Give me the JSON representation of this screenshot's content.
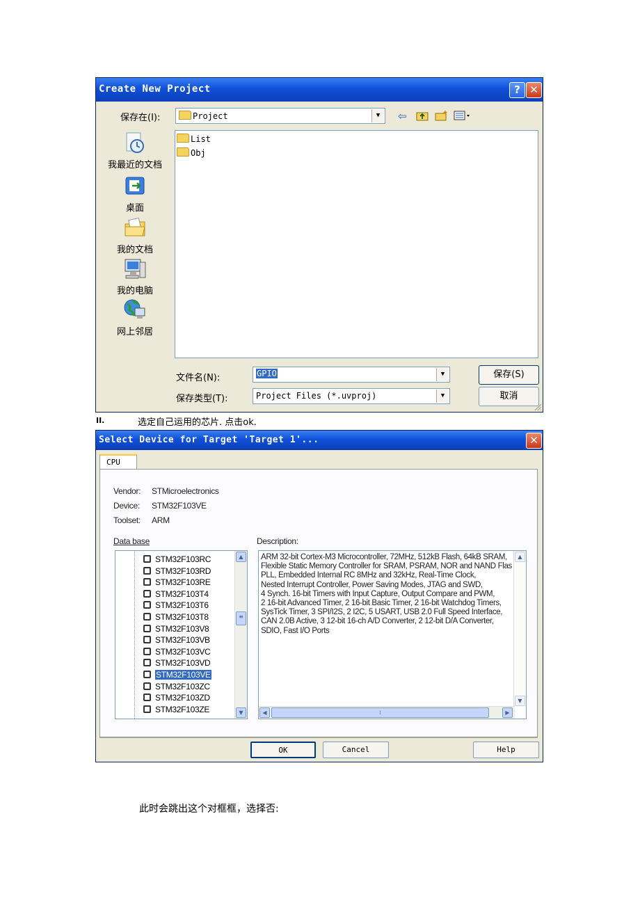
{
  "dialog1": {
    "title": "Create New Project",
    "save_in_label": "保存在(I):",
    "save_in_value": "Project",
    "places": [
      "我最近的文档",
      "桌面",
      "我的文档",
      "我的电脑",
      "网上邻居"
    ],
    "files": [
      "List",
      "Obj"
    ],
    "filename_label": "文件名(N):",
    "filename_value": "GPIO",
    "filetype_label": "保存类型(T):",
    "filetype_value": "Project Files (*.uvproj)",
    "save_button": "保存(S)",
    "cancel_button": "取消",
    "help_glyph": "?",
    "close_glyph": "✕"
  },
  "instruction": {
    "number": "II.",
    "text": "选定自己运用的芯片. 点击ok."
  },
  "dialog2": {
    "title": "Select Device for Target 'Target 1'...",
    "close_glyph": "✕",
    "tab": "CPU",
    "vendor_label": "Vendor:",
    "vendor_value": "STMicroelectronics",
    "device_label": "Device:",
    "device_value": "STM32F103VE",
    "toolset_label": "Toolset:",
    "toolset_value": "ARM",
    "database_label": "Data base",
    "description_label": "Description:",
    "devices": [
      "STM32F103RC",
      "STM32F103RD",
      "STM32F103RE",
      "STM32F103T4",
      "STM32F103T6",
      "STM32F103T8",
      "STM32F103V8",
      "STM32F103VB",
      "STM32F103VC",
      "STM32F103VD",
      "STM32F103VE",
      "STM32F103ZC",
      "STM32F103ZD",
      "STM32F103ZE"
    ],
    "selected_device": "STM32F103VE",
    "description": "ARM 32-bit Cortex-M3 Microcontroller, 72MHz, 512kB Flash, 64kB SRAM,\nFlexible Static Memory Controller for SRAM, PSRAM, NOR and NAND Flas\nPLL, Embedded Internal RC 8MHz and 32kHz, Real-Time Clock,\nNested Interrupt Controller, Power Saving Modes, JTAG and SWD,\n4 Synch. 16-bit Timers with Input Capture, Output Compare and PWM,\n2 16-bit Advanced Timer, 2 16-bit Basic Timer, 2 16-bit Watchdog Timers,\nSysTick Timer, 3 SPI/I2S, 2 I2C, 5 USART, USB 2.0 Full Speed Interface,\nCAN 2.0B Active, 3 12-bit 16-ch A/D Converter, 2 12-bit D/A Converter,\nSDIO, Fast I/O Ports",
    "ok_button": "OK",
    "cancel_button": "Cancel",
    "help_button": "Help"
  },
  "footer_text": "此时会跳出这个对框框，选择否:"
}
